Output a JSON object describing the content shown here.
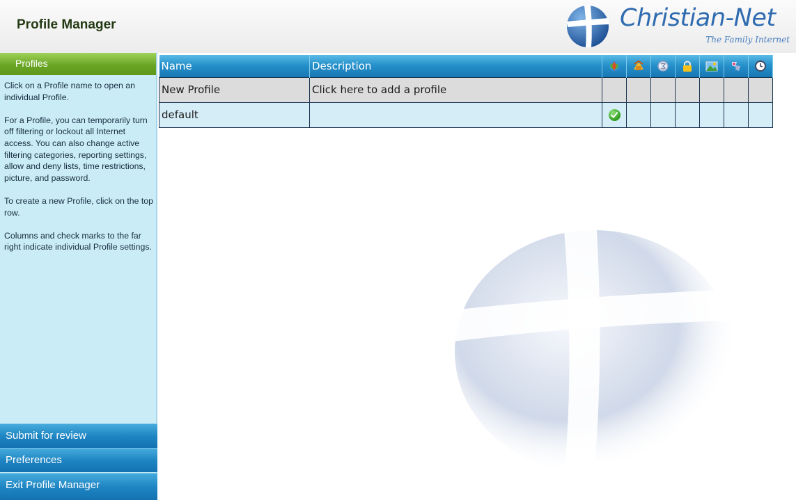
{
  "app": {
    "title": "Profile Manager"
  },
  "logo": {
    "name": "Christian-Net",
    "tagline": "The Family Internet"
  },
  "sidebar": {
    "header": "Profiles",
    "help": [
      "Click on a Profile name to open an individual Profile.",
      "For a Profile, you can temporarily turn off filtering or lockout all Internet access. You can also change active filtering categories, reporting settings, allow and deny lists, time restrictions, picture, and password.",
      "To create a new Profile, click on the top row.",
      "Columns and check marks to the far right indicate individual Profile settings."
    ],
    "buttons": {
      "submit": "Submit for review",
      "preferences": "Preferences",
      "exit": "Exit Profile Manager"
    }
  },
  "table": {
    "columns": {
      "name": "Name",
      "description": "Description"
    },
    "setting_icons": [
      "filter-toggle-icon",
      "categories-icon",
      "reporting-icon",
      "lock-icon",
      "picture-icon",
      "lists-icon",
      "clock-icon"
    ],
    "rows": [
      {
        "name": "New Profile",
        "description": "Click here to add a profile",
        "settings": [
          false,
          false,
          false,
          false,
          false,
          false,
          false
        ]
      },
      {
        "name": "default",
        "description": "",
        "settings": [
          true,
          false,
          false,
          false,
          false,
          false,
          false
        ]
      }
    ]
  },
  "colors": {
    "header_green": "#6aa624",
    "button_blue": "#1f86c3",
    "sidebar_bg": "#c9ecf6",
    "row_new_bg": "#dcdcdc",
    "row_default_bg": "#d5edf6",
    "logo_blue": "#2f6bb0"
  }
}
